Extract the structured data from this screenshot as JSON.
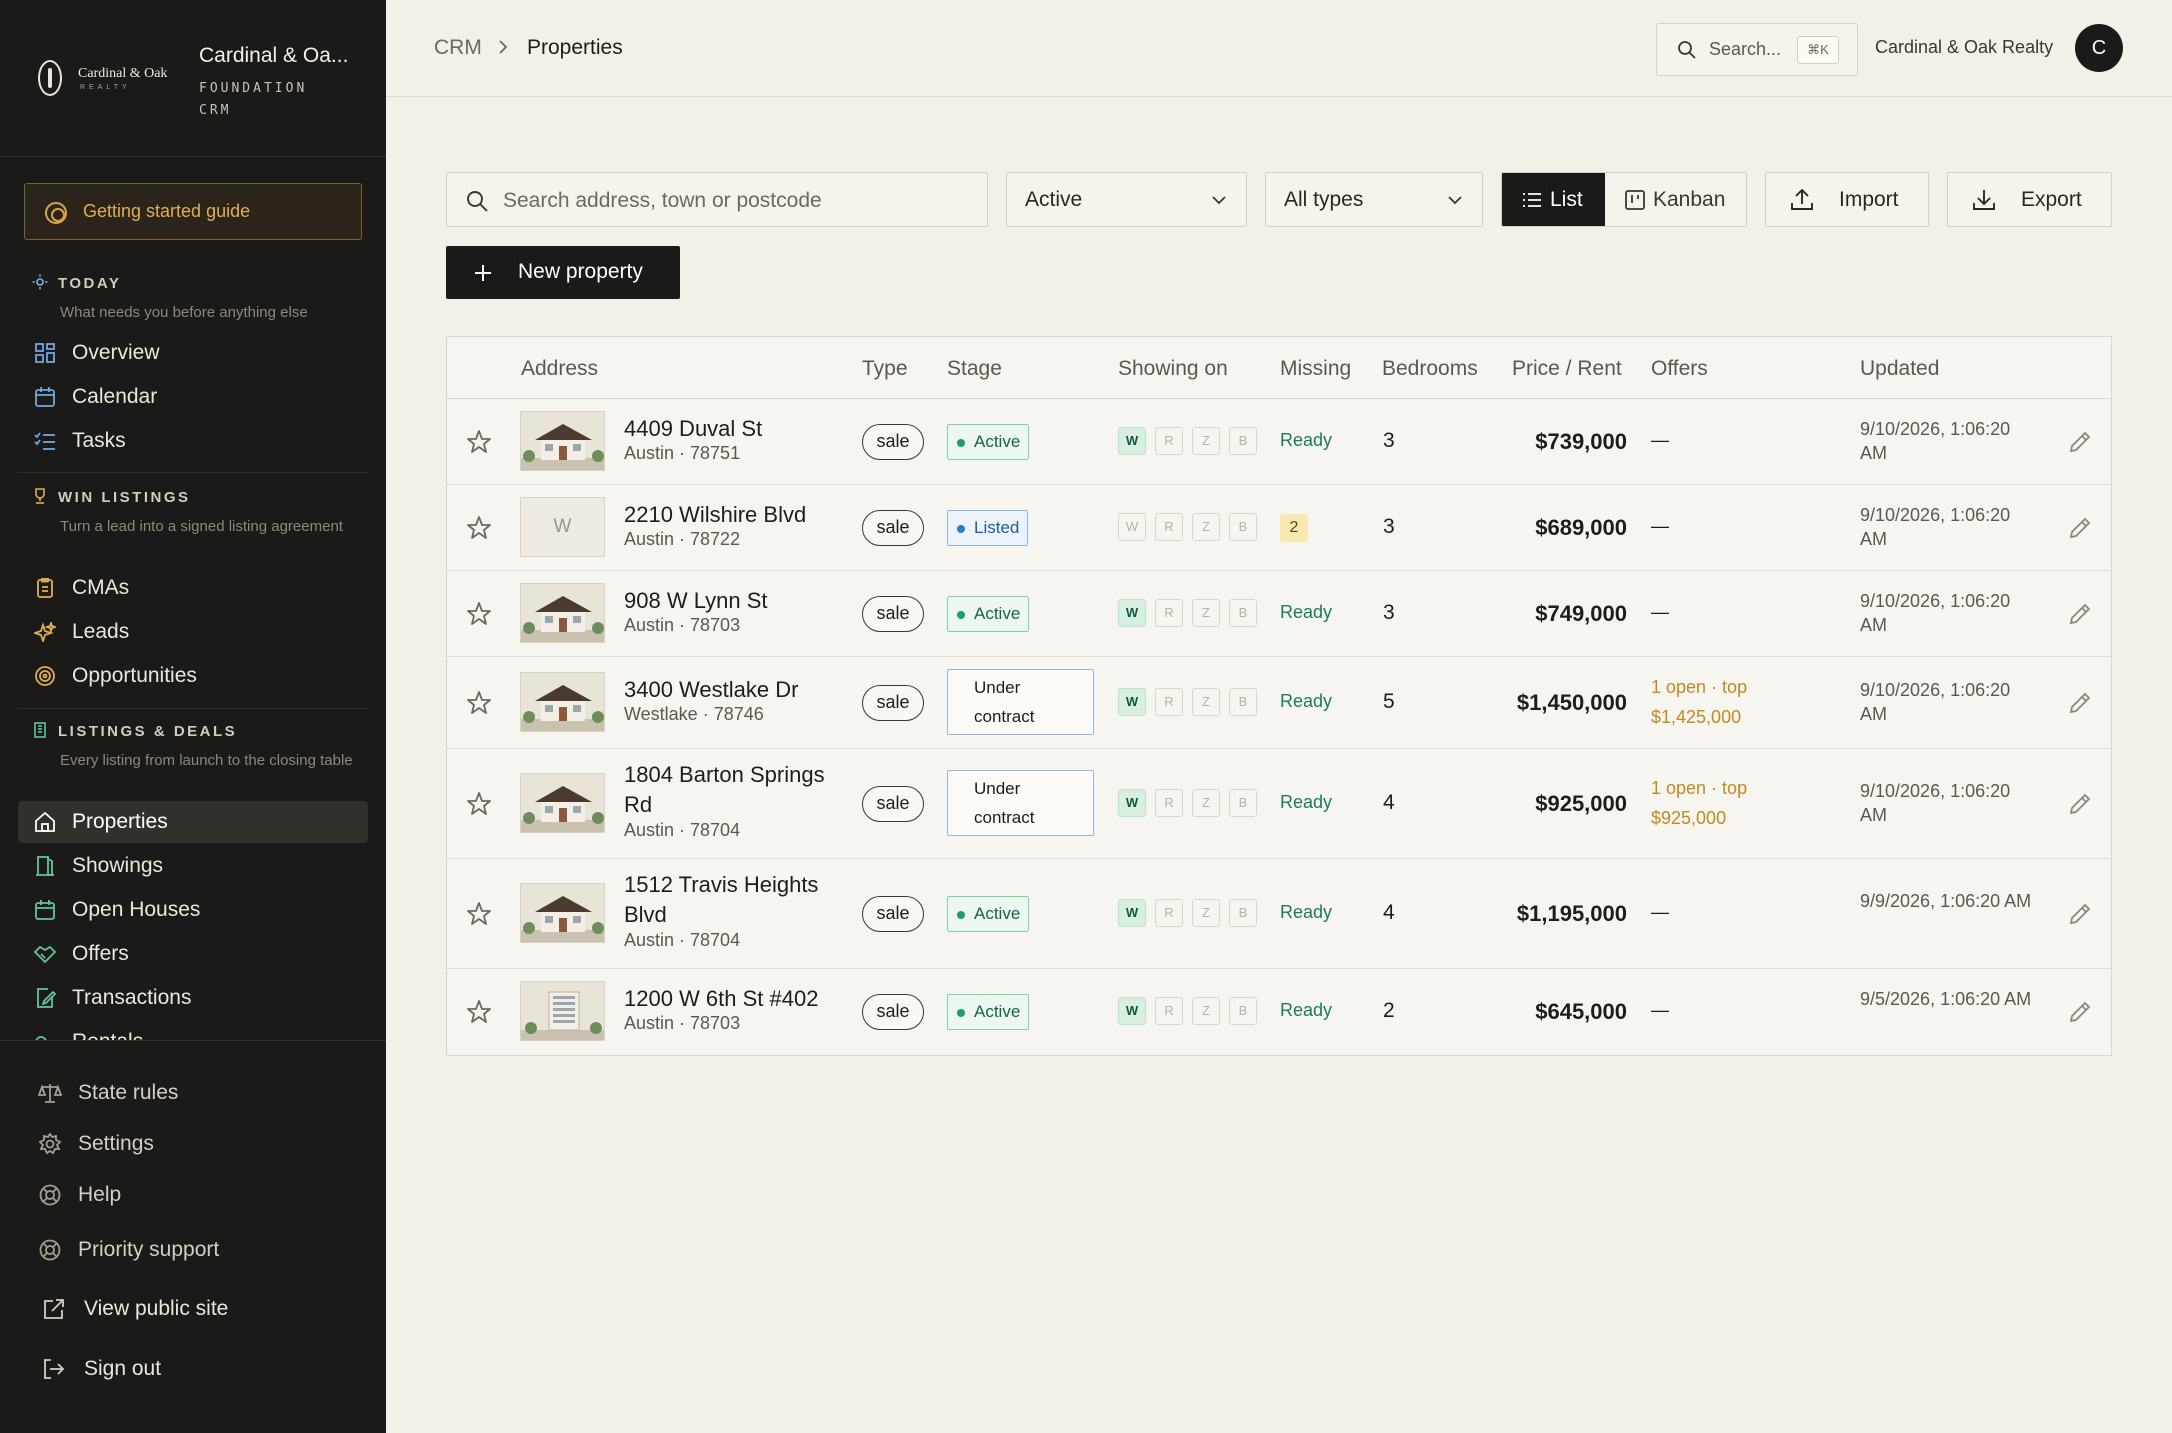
{
  "brand": {
    "logo_text": "Cardinal & Oak",
    "logo_sub": "REALTY",
    "name": "Cardinal & Oa...",
    "sub": "FOUNDATION CRM"
  },
  "sidebar": {
    "guide_label": "Getting started guide",
    "sections": [
      {
        "title": "TODAY",
        "desc": "What needs you before anything else",
        "items": [
          {
            "label": "Overview",
            "icon": "grid-icon"
          },
          {
            "label": "Calendar",
            "icon": "calendar-icon"
          },
          {
            "label": "Tasks",
            "icon": "checklist-icon"
          }
        ]
      },
      {
        "title": "WIN LISTINGS",
        "desc": "Turn a lead into a signed listing agreement",
        "items": [
          {
            "label": "CMAs",
            "icon": "clipboard-icon"
          },
          {
            "label": "Leads",
            "icon": "sparkles-icon"
          },
          {
            "label": "Opportunities",
            "icon": "target-icon"
          }
        ]
      },
      {
        "title": "LISTINGS & DEALS",
        "desc": "Every listing from launch to the closing table",
        "items": [
          {
            "label": "Properties",
            "icon": "home-icon"
          },
          {
            "label": "Showings",
            "icon": "door-icon"
          },
          {
            "label": "Open Houses",
            "icon": "calendar-open-icon"
          },
          {
            "label": "Offers",
            "icon": "handshake-icon"
          },
          {
            "label": "Transactions",
            "icon": "document-edit-icon"
          },
          {
            "label": "Rentals",
            "icon": "key-icon"
          }
        ]
      }
    ],
    "bottom_items": [
      {
        "label": "State rules",
        "icon": "scale-icon"
      },
      {
        "label": "Settings",
        "icon": "gear-icon"
      },
      {
        "label": "Help",
        "icon": "lifebuoy-icon"
      },
      {
        "label": "Priority support",
        "icon": "lifebuoy-icon"
      },
      {
        "label": "View public site",
        "icon": "external-link-icon"
      },
      {
        "label": "Sign out",
        "icon": "sign-out-icon"
      }
    ]
  },
  "topbar": {
    "breadcrumb_root": "CRM",
    "breadcrumb_current": "Properties",
    "search_label": "Search...",
    "search_shortcut": "⌘K",
    "org_name": "Cardinal & Oak Realty",
    "avatar_initial": "C"
  },
  "toolbar": {
    "search_placeholder": "Search address, town or postcode",
    "status_value": "Active",
    "type_value": "All types",
    "view_list": "List",
    "view_kanban": "Kanban",
    "import_label": "Import",
    "export_label": "Export",
    "new_property_label": "New property"
  },
  "table": {
    "columns": [
      "Address",
      "Type",
      "Stage",
      "Showing on",
      "Missing",
      "Bedrooms",
      "Price / Rent",
      "Offers",
      "Updated"
    ],
    "showing_sites": [
      "W",
      "R",
      "Z",
      "B"
    ],
    "rows": [
      {
        "address": "4409 Duval St",
        "town": "Austin · 78751",
        "type": "sale",
        "stage": "Active",
        "stage_kind": "active",
        "showing": [
          true,
          false,
          false,
          false
        ],
        "missing": "Ready",
        "bedrooms": "3",
        "price": "$739,000",
        "offers": "—",
        "updated": "9/10/2026, 1:06:20 AM",
        "thumb": "house"
      },
      {
        "address": "2210 Wilshire Blvd",
        "town": "Austin · 78722",
        "type": "sale",
        "stage": "Listed",
        "stage_kind": "listed",
        "showing": [
          false,
          false,
          false,
          false
        ],
        "missing": "2",
        "bedrooms": "3",
        "price": "$689,000",
        "offers": "—",
        "updated": "9/10/2026, 1:06:20 AM",
        "thumb": "W"
      },
      {
        "address": "908 W Lynn St",
        "town": "Austin · 78703",
        "type": "sale",
        "stage": "Active",
        "stage_kind": "active",
        "showing": [
          true,
          false,
          false,
          false
        ],
        "missing": "Ready",
        "bedrooms": "3",
        "price": "$749,000",
        "offers": "—",
        "updated": "9/10/2026, 1:06:20 AM",
        "thumb": "house"
      },
      {
        "address": "3400 Westlake Dr",
        "town": "Westlake · 78746",
        "type": "sale",
        "stage": "Under contract",
        "stage_kind": "uc",
        "showing": [
          true,
          false,
          false,
          false
        ],
        "missing": "Ready",
        "bedrooms": "5",
        "price": "$1,450,000",
        "offers": "1 open · top $1,425,000",
        "updated": "9/10/2026, 1:06:20 AM",
        "thumb": "house"
      },
      {
        "address": "1804 Barton Springs Rd",
        "town": "Austin · 78704",
        "type": "sale",
        "stage": "Under contract",
        "stage_kind": "uc",
        "showing": [
          true,
          false,
          false,
          false
        ],
        "missing": "Ready",
        "bedrooms": "4",
        "price": "$925,000",
        "offers": "1 open · top $925,000",
        "updated": "9/10/2026, 1:06:20 AM",
        "thumb": "house"
      },
      {
        "address": "1512 Travis Heights Blvd",
        "town": "Austin · 78704",
        "type": "sale",
        "stage": "Active",
        "stage_kind": "active",
        "showing": [
          true,
          false,
          false,
          false
        ],
        "missing": "Ready",
        "bedrooms": "4",
        "price": "$1,195,000",
        "offers": "—",
        "updated": "9/9/2026, 1:06:20 AM",
        "thumb": "house"
      },
      {
        "address": "1200 W 6th St #402",
        "town": "Austin · 78703",
        "type": "sale",
        "stage": "Active",
        "stage_kind": "active",
        "showing": [
          true,
          false,
          false,
          false
        ],
        "missing": "Ready",
        "bedrooms": "2",
        "price": "$645,000",
        "offers": "—",
        "updated": "9/5/2026, 1:06:20 AM",
        "thumb": "condo"
      }
    ]
  },
  "colors": {
    "sidebar_bg": "#1b1a18",
    "page_bg": "#f3f0e8",
    "accent_gold": "#d9a54a",
    "ready_green": "#1e7b57"
  }
}
